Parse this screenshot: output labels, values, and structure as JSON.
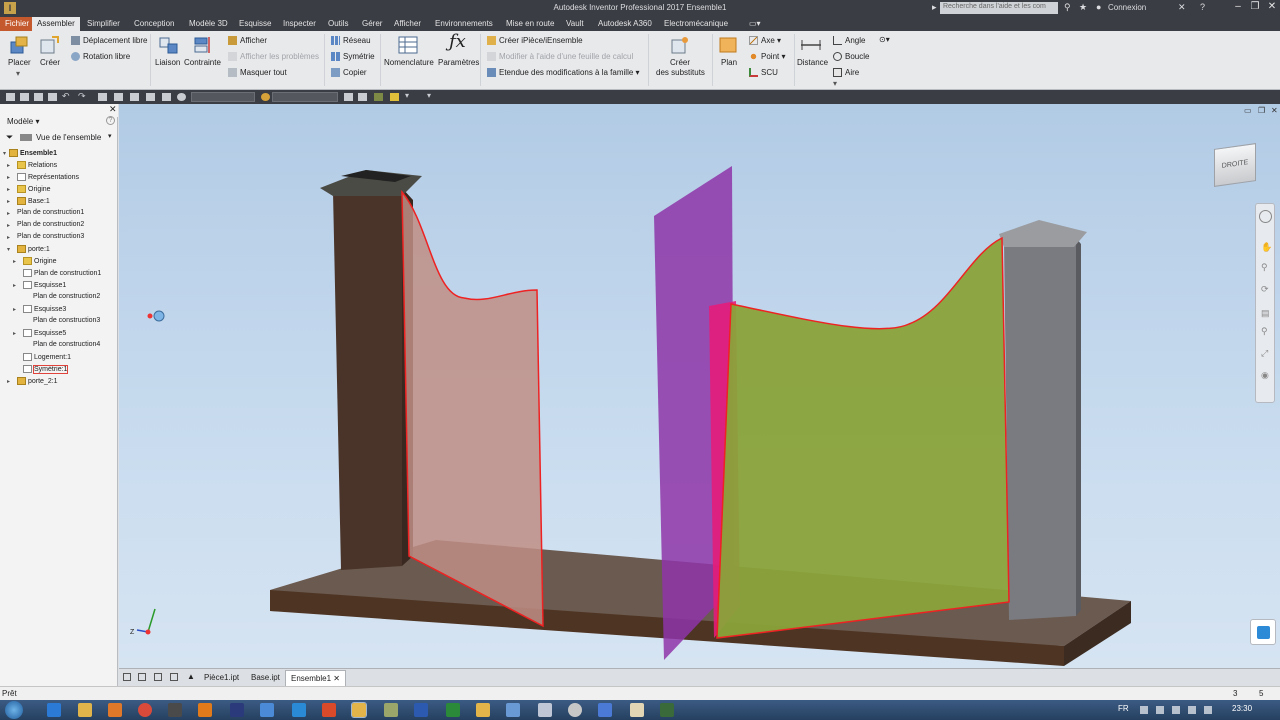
{
  "window": {
    "app_title": "Autodesk Inventor Professional 2017    Ensemble1",
    "search_placeholder": "Recherche dans l'aide et les com",
    "signin": "Connexion"
  },
  "tabs": [
    {
      "label": "Fichier",
      "type": "file"
    },
    {
      "label": "Assembler",
      "type": "active"
    },
    {
      "label": "Simplifier"
    },
    {
      "label": "Conception"
    },
    {
      "label": "Modèle 3D"
    },
    {
      "label": "Esquisse"
    },
    {
      "label": "Inspecter"
    },
    {
      "label": "Outils"
    },
    {
      "label": "Gérer"
    },
    {
      "label": "Afficher"
    },
    {
      "label": "Environnements"
    },
    {
      "label": "Mise en route"
    },
    {
      "label": "Vault"
    },
    {
      "label": "Autodesk A360"
    },
    {
      "label": "Electromécanique"
    }
  ],
  "ribbon": {
    "placer": "Placer",
    "creer": "Créer",
    "deplacement_libre": "Déplacement libre",
    "rotation_libre": "Rotation libre",
    "liaison": "Liaison",
    "contrainte": "Contrainte",
    "afficher": "Afficher",
    "afficher_problemes": "Afficher les problèmes",
    "masquer_tout": "Masquer tout",
    "reseau": "Réseau",
    "symetrie": "Symétrie",
    "copier": "Copier",
    "nomenclature": "Nomenclature",
    "parametres": "Paramètres",
    "creer_ipiece": "Créer iPièce/iEnsemble",
    "modifier_feuille": "Modifier à l'aide d'une feuille de calcul",
    "etendue_modif": "Etendue des modifications à la famille",
    "creer_substituts_1": "Créer",
    "creer_substituts_2": "des substituts",
    "plan": "Plan",
    "axe": "Axe",
    "point": "Point",
    "scu": "SCU",
    "distance": "Distance",
    "angle": "Angle",
    "boucle": "Boucle",
    "aire": "Aire"
  },
  "browser": {
    "title": "Modèle",
    "view": "Vue de l'ensemble",
    "items": [
      {
        "label": "Ensemble1",
        "icon": "assembly-icon",
        "bold": true
      },
      {
        "label": "Relations",
        "icon": "folder-icon"
      },
      {
        "label": "Représentations",
        "icon": "representations-icon"
      },
      {
        "label": "Origine",
        "icon": "folder-icon"
      },
      {
        "label": "Base:1",
        "icon": "part-icon"
      },
      {
        "label": "Plan de construction1",
        "icon": "plane-icon"
      },
      {
        "label": "Plan de construction2",
        "icon": "plane-icon"
      },
      {
        "label": "Plan de construction3",
        "icon": "plane-icon"
      },
      {
        "label": "porte:1",
        "icon": "part-icon"
      },
      {
        "label": "Origine",
        "icon": "folder-icon"
      },
      {
        "label": "Plan de construction1",
        "icon": "plane-icon"
      },
      {
        "label": "Esquisse1",
        "icon": "sketch-icon"
      },
      {
        "label": "Plan de construction2",
        "icon": "plane-icon"
      },
      {
        "label": "Esquisse3",
        "icon": "sketch-icon"
      },
      {
        "label": "Plan de construction3",
        "icon": "plane-icon"
      },
      {
        "label": "Esquisse5",
        "icon": "sketch-icon"
      },
      {
        "label": "Plan de construction4",
        "icon": "plane-icon"
      },
      {
        "label": "Logement:1",
        "icon": "pocket-icon"
      },
      {
        "label": "Symétrie:1",
        "icon": "mirror-icon"
      },
      {
        "label": "porte_2:1",
        "icon": "part-icon"
      }
    ]
  },
  "viewcube": {
    "face": "DROITE"
  },
  "doctabs": [
    {
      "label": "Pièce1.ipt"
    },
    {
      "label": "Base.ipt"
    },
    {
      "label": "Ensemble1",
      "active": true
    }
  ],
  "status": {
    "text": "Prêt",
    "count1": "3",
    "count2": "5"
  },
  "taskbar": {
    "lang": "FR",
    "clock": "23:30"
  }
}
